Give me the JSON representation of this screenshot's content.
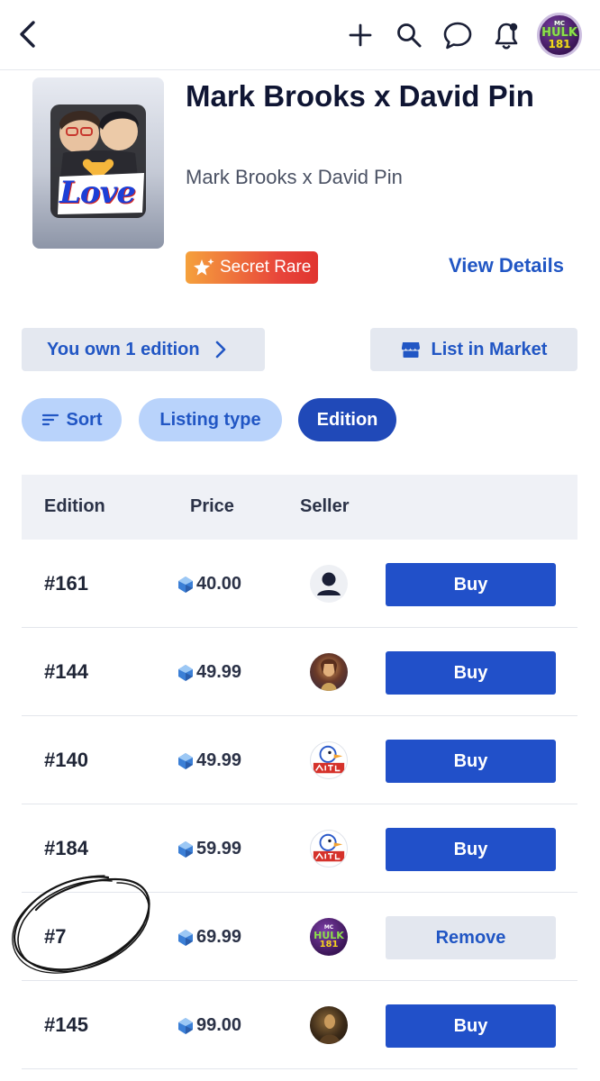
{
  "header": {
    "back_icon": "chevron-left-icon",
    "actions": [
      "plus-icon",
      "search-icon",
      "chat-bubble-icon",
      "bell-icon"
    ],
    "profile_avatar": {
      "line1": "MC",
      "line2": "HULK",
      "line3": "181"
    }
  },
  "item": {
    "title": "Mark Brooks x David Pin",
    "subtitle": "Mark Brooks x David Pin",
    "cover_text": "Love",
    "rarity": "Secret Rare",
    "view_details": "View Details"
  },
  "actions": {
    "own_label": "You own 1 edition",
    "list_label": "List in Market"
  },
  "filters": {
    "sort": "Sort",
    "listing_type": "Listing type",
    "edition": "Edition"
  },
  "table": {
    "headers": {
      "edition": "Edition",
      "price": "Price",
      "seller": "Seller"
    },
    "rows": [
      {
        "edition": "#161",
        "price": "40.00",
        "seller": "default-user",
        "action": "Buy"
      },
      {
        "edition": "#144",
        "price": "49.99",
        "seller": "photo",
        "action": "Buy"
      },
      {
        "edition": "#140",
        "price": "49.99",
        "seller": "duck",
        "action": "Buy"
      },
      {
        "edition": "#184",
        "price": "59.99",
        "seller": "duck",
        "action": "Buy"
      },
      {
        "edition": "#7",
        "price": "69.99",
        "seller": "hulk",
        "action": "Remove"
      },
      {
        "edition": "#145",
        "price": "99.00",
        "seller": "dark",
        "action": "Buy"
      }
    ]
  },
  "colors": {
    "primary": "#2150c9",
    "chip_light": "#b9d3fb",
    "chip_active": "#2049b8",
    "rarity_start": "#f5a13c",
    "rarity_end": "#e0342f"
  }
}
